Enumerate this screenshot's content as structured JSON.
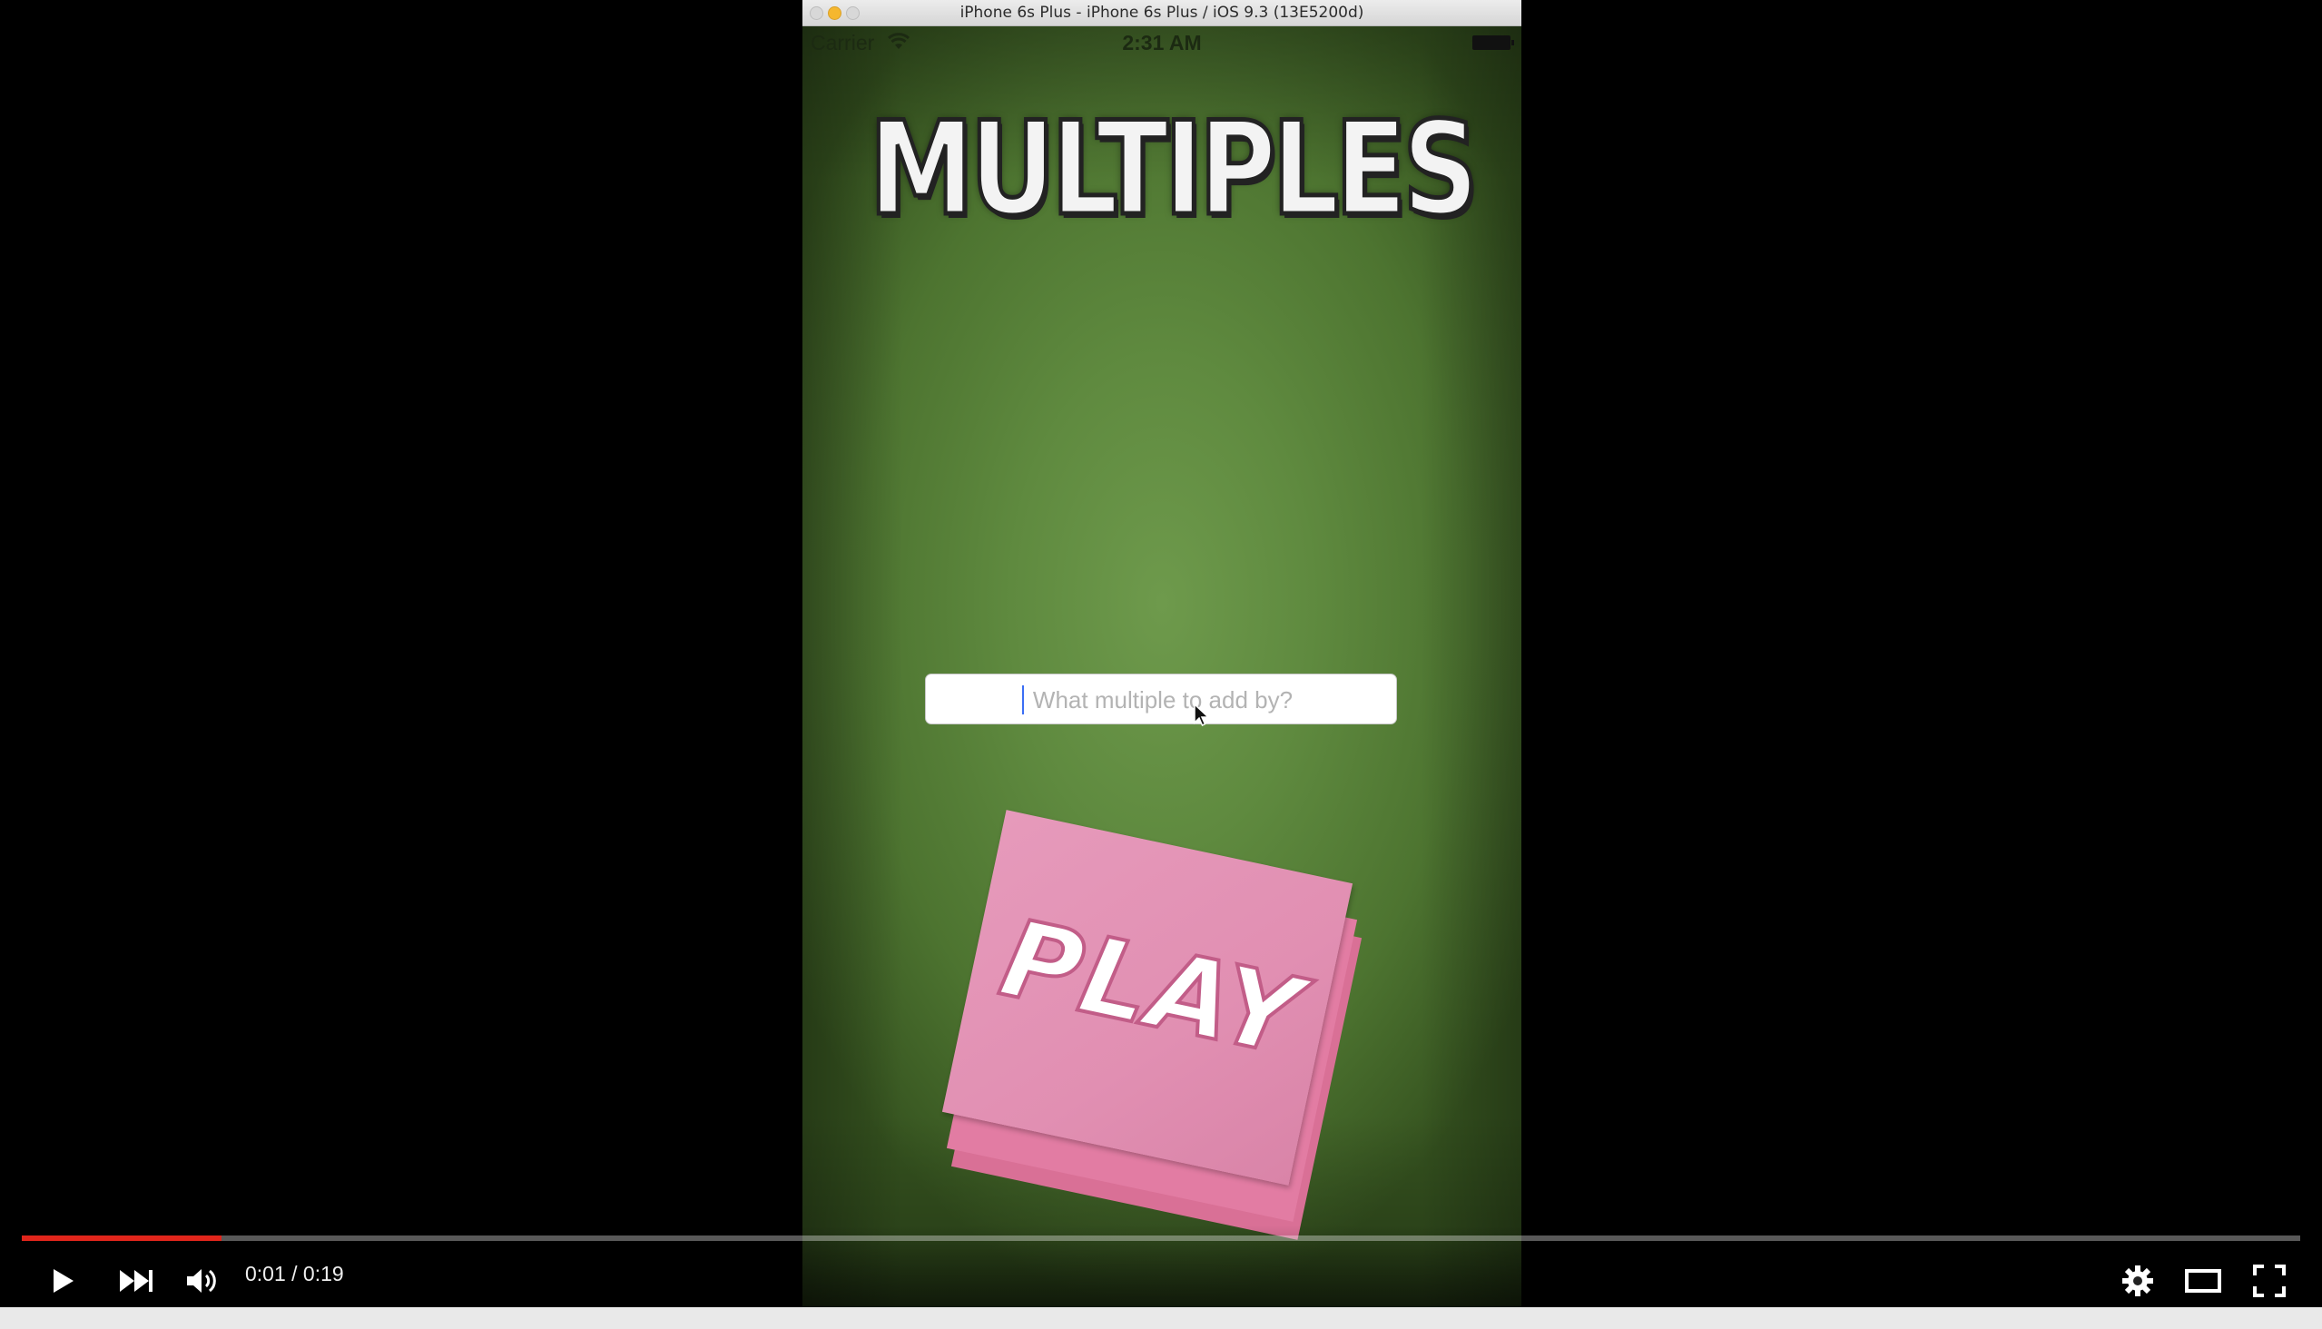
{
  "simulator": {
    "window_title": "iPhone 6s Plus - iPhone 6s Plus / iOS 9.3 (13E5200d)"
  },
  "status_bar": {
    "carrier": "Carrier",
    "time": "2:31 AM"
  },
  "app": {
    "logo_text": "MULTIPLES",
    "multiple_input": {
      "placeholder": "What multiple to add by?",
      "value": ""
    },
    "play_label": "PLAY",
    "colors": {
      "background": "#5f8a3f",
      "note": "#e18fb2"
    }
  },
  "video_player": {
    "time_display": "0:01 / 0:19",
    "progress": 0.0875,
    "progress_color": "#e1251b",
    "icons": [
      "play-icon",
      "next-icon",
      "volume-icon",
      "settings-icon",
      "theater-mode-icon",
      "fullscreen-icon"
    ]
  }
}
